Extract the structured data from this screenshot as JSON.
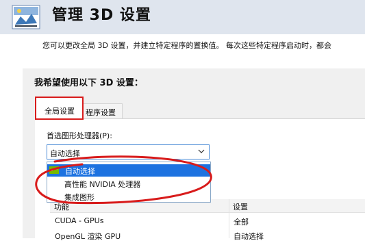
{
  "header": {
    "title": "管理 3D 设置",
    "icon": "3d-settings-icon"
  },
  "description": "您可以更改全局 3D 设置，并建立特定程序的置换值。 每次这些特定程序启动时，都会",
  "panel": {
    "title": "我希望使用以下 3D 设置："
  },
  "tabs": [
    {
      "label": "全局设置",
      "selected": true
    },
    {
      "label": "程序设置",
      "selected": false
    }
  ],
  "preferred_processor": {
    "label": "首选图形处理器(P):",
    "value": "自动选择",
    "options": [
      "自动选择",
      "高性能 NVIDIA 处理器",
      "集成图形"
    ],
    "highlighted_option": "自动选择"
  },
  "table": {
    "headers": [
      "功能",
      "设置"
    ],
    "rows": [
      {
        "feature": "CUDA - GPUs",
        "setting": "全部"
      },
      {
        "feature": "OpenGL 渲染 GPU",
        "setting": "自动选择"
      }
    ]
  },
  "colors": {
    "annotation_red": "#d81b1b",
    "selection_blue": "#1d72e0",
    "header_bg": "#dfe5ee",
    "nvidia_green": "#76b900"
  }
}
